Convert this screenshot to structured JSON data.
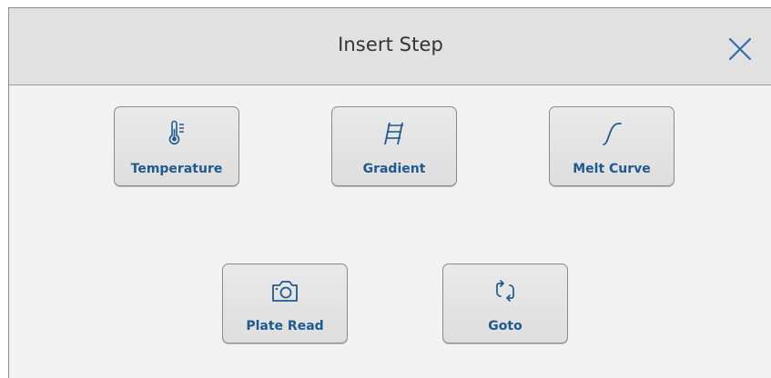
{
  "dialog": {
    "title": "Insert Step",
    "close_icon": "close-icon"
  },
  "steps": [
    {
      "label": "Temperature",
      "icon": "thermometer-icon"
    },
    {
      "label": "Gradient",
      "icon": "gradient-icon"
    },
    {
      "label": "Melt Curve",
      "icon": "melt-curve-icon"
    },
    {
      "label": "Plate Read",
      "icon": "camera-icon"
    },
    {
      "label": "Goto",
      "icon": "goto-icon"
    }
  ],
  "colors": {
    "accent": "#1d5a90",
    "header_bg": "#e1e1e1",
    "body_bg": "#f2f2f2"
  }
}
